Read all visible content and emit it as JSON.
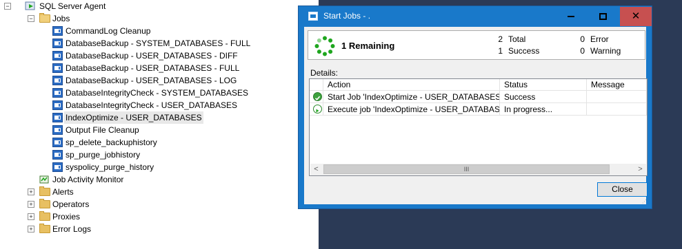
{
  "tree": {
    "root": "SQL Server Agent",
    "jobs_folder": "Jobs",
    "jobs": [
      "CommandLog Cleanup",
      "DatabaseBackup - SYSTEM_DATABASES - FULL",
      "DatabaseBackup - USER_DATABASES - DIFF",
      "DatabaseBackup - USER_DATABASES - FULL",
      "DatabaseBackup - USER_DATABASES - LOG",
      "DatabaseIntegrityCheck - SYSTEM_DATABASES",
      "DatabaseIntegrityCheck - USER_DATABASES",
      "IndexOptimize - USER_DATABASES",
      "Output File Cleanup",
      "sp_delete_backuphistory",
      "sp_purge_jobhistory",
      "syspolicy_purge_history"
    ],
    "selected_job_index": 7,
    "job_activity_monitor": "Job Activity Monitor",
    "folders": [
      "Alerts",
      "Operators",
      "Proxies",
      "Error Logs"
    ]
  },
  "dialog": {
    "title": "Start Jobs - .",
    "remaining": "1  Remaining",
    "total_num": "2",
    "total_label": "Total",
    "success_num": "1",
    "success_label": "Success",
    "error_num": "0",
    "error_label": "Error",
    "warning_num": "0",
    "warning_label": "Warning",
    "details_label": "Details:",
    "columns": [
      "Action",
      "Status",
      "Message"
    ],
    "rows": [
      {
        "action": "Start Job 'IndexOptimize - USER_DATABASES'",
        "status": "Success",
        "message": "",
        "icon": "success-check-icon"
      },
      {
        "action": "Execute job 'IndexOptimize - USER_DATABASES'",
        "status": "In progress...",
        "message": "",
        "icon": "in-progress-icon"
      }
    ],
    "close_label": "Close",
    "scroll_left": "<",
    "scroll_right": ">",
    "scroll_thumb": "III"
  },
  "colors": {
    "titlebar": "#1979ca",
    "close_button": "#c75050",
    "desktop": "#2b3a56",
    "spinner": "#1fa61f"
  }
}
